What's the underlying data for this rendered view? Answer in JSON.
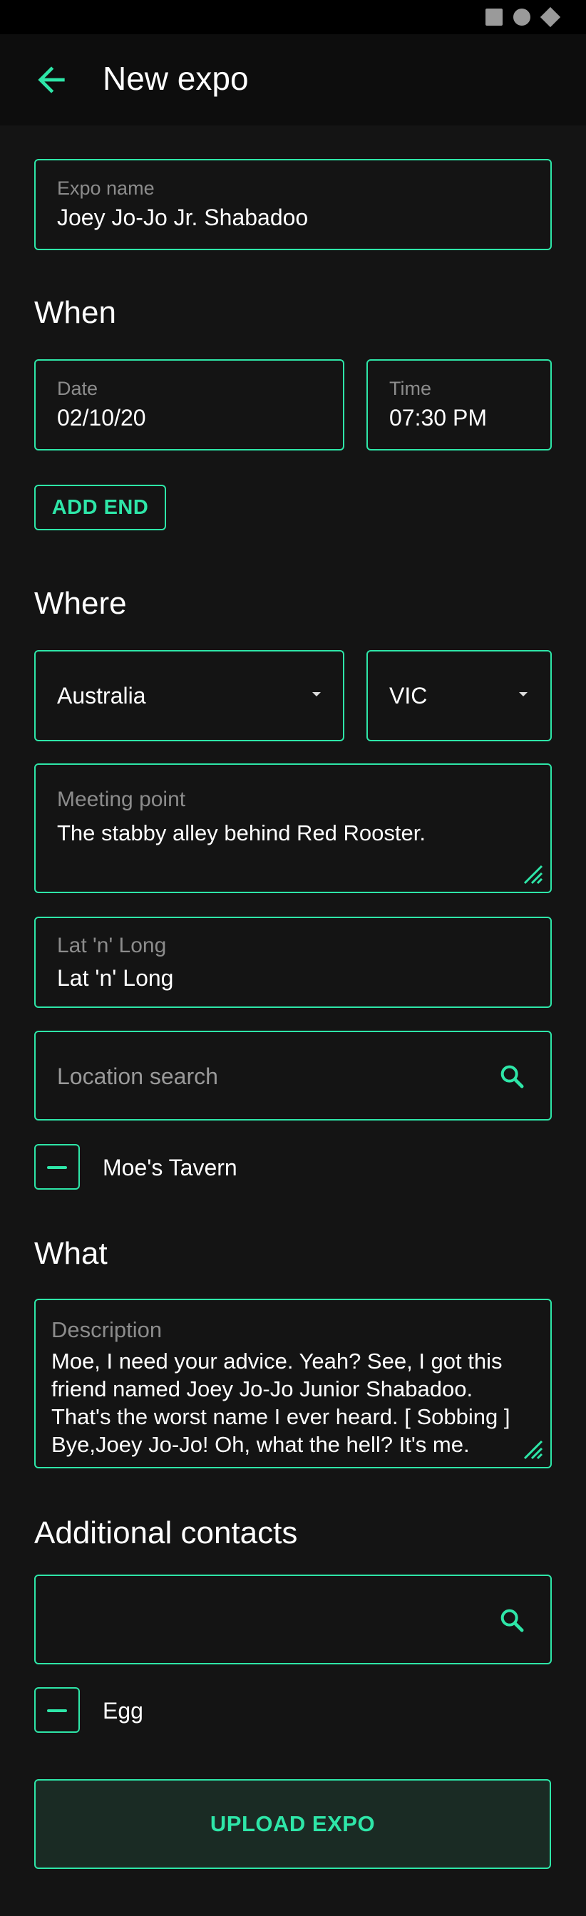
{
  "app_bar": {
    "title": "New expo"
  },
  "expo_name": {
    "label": "Expo name",
    "value": "Joey Jo-Jo Jr. Shabadoo"
  },
  "when": {
    "title": "When",
    "date": {
      "label": "Date",
      "value": "02/10/20"
    },
    "time": {
      "label": "Time",
      "value": "07:30 PM"
    },
    "add_end_label": "ADD END"
  },
  "where": {
    "title": "Where",
    "country": {
      "selected": "Australia"
    },
    "state": {
      "selected": "VIC"
    },
    "meeting_point": {
      "label": "Meeting point",
      "value": "The stabby alley behind Red Rooster."
    },
    "lat_long": {
      "label": "Lat 'n' Long",
      "value": "Lat 'n' Long"
    },
    "location_search": {
      "placeholder": "Location search"
    },
    "selected_locations": [
      {
        "name": "Moe's Tavern"
      }
    ]
  },
  "what": {
    "title": "What",
    "description": {
      "label": "Description",
      "value": "Moe, I need your advice. Yeah? See, I got this friend named Joey Jo-Jo Junior Shabadoo. That's the worst name I ever heard. [ Sobbing ] Bye,Joey Jo-Jo! Oh, what the hell? It's me."
    }
  },
  "contacts": {
    "title": "Additional contacts",
    "search": {
      "value": ""
    },
    "selected": [
      {
        "name": "Egg"
      }
    ]
  },
  "upload_label": "UPLOAD EXPO",
  "colors": {
    "accent": "#2ee6a8",
    "background": "#141414",
    "app_bar": "#0d0d0d"
  },
  "icons": {
    "back": "arrow-left-icon",
    "dropdown": "caret-down-icon",
    "resize": "resize-handle-icon",
    "search": "search-icon",
    "remove": "minus-icon"
  }
}
